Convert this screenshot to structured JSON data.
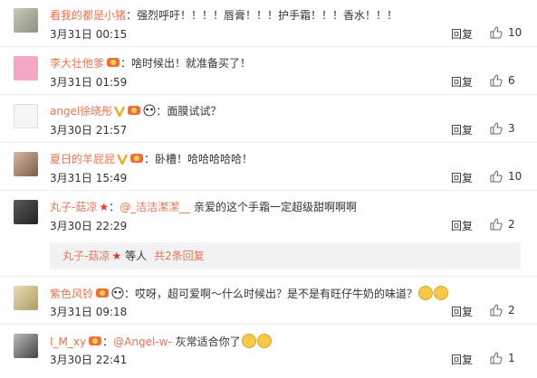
{
  "actions": {
    "reply_label": "回复"
  },
  "comments": [
    {
      "user": "看我的都是小猪",
      "sep": "：",
      "text": "强烈呼吁！！！！唇膏！！！护手霜！！！香水！！！",
      "time": "3月31日 00:15",
      "likes": "10"
    },
    {
      "user": "李大壮他爹",
      "sep": "：",
      "text": "啥时候出！就准备买了！",
      "time": "3月31日 01:59",
      "likes": "6"
    },
    {
      "user": "angel徐晓彤",
      "sep": "：",
      "text": "面膜试试？",
      "time": "3月30日 21:57",
      "likes": "3"
    },
    {
      "user": "夏日的羊屁屁",
      "sep": "：",
      "text": "卧槽！哈哈哈哈哈！",
      "time": "3月31日 15:49",
      "likes": "10"
    },
    {
      "user": "丸子-菇凉",
      "sep": "：",
      "mention": "@_洁洁潔潔__",
      "text": " 亲爱的这个手霜一定超级甜啊啊啊",
      "time": "3月30日 22:29",
      "likes": "2"
    },
    {
      "user": "紫色风铃",
      "sep": "：",
      "text": "哎呀，超可爱啊～什么时候出？是不是有旺仔牛奶的味道？",
      "time": "3月31日 09:18",
      "likes": "2"
    },
    {
      "user": "I_M_xy",
      "sep": "：",
      "mention": "@Angel-w-",
      "text": " 灰常适合你了",
      "time": "3月30日 22:41",
      "likes": "1"
    }
  ],
  "subreply": {
    "user": "丸子-菇凉",
    "text": "等人",
    "link": "共2条回复"
  }
}
